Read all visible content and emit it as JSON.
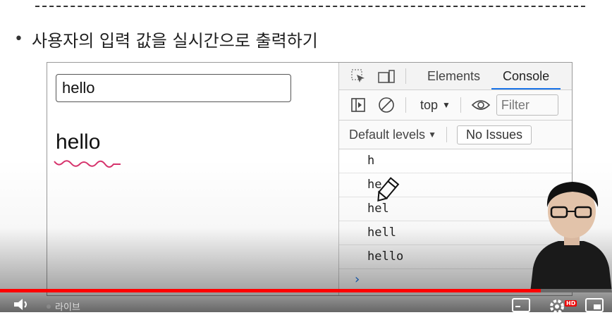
{
  "slide": {
    "bullet_text": "사용자의 입력 값을 실시간으로 출력하기"
  },
  "demo": {
    "input_value": "hello",
    "output_text": "hello"
  },
  "devtools": {
    "tabs": [
      {
        "label": "Elements",
        "active": false
      },
      {
        "label": "Console",
        "active": true
      }
    ],
    "context": "top",
    "filter_placeholder": "Filter",
    "levels": "Default levels",
    "issues": "No Issues",
    "log_entries": [
      "h",
      "he",
      "hel",
      "hell",
      "hello"
    ],
    "prompt": "›"
  },
  "player": {
    "progress": 0.884,
    "live_label": "라이브",
    "hd_badge": "HD"
  },
  "colors": {
    "accent": "#1a73e8",
    "progress": "#ff0000",
    "squiggle": "#d6336c"
  }
}
